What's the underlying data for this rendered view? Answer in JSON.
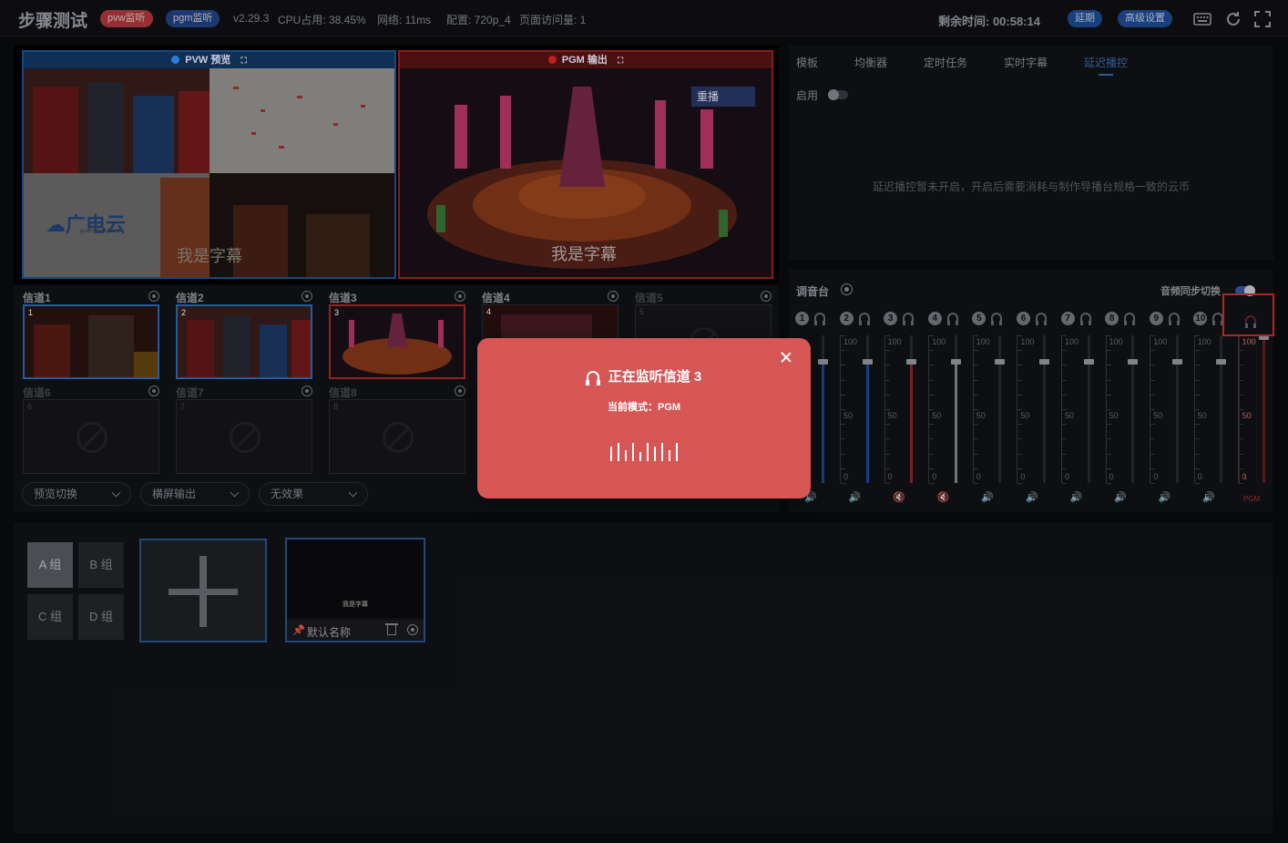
{
  "topbar": {
    "title": "步骤测试",
    "pvw_badge": "pvw监听",
    "pgm_badge": "pgm监听",
    "version": "v2.29.3",
    "cpu": "CPU占用: 38.45%",
    "network": "网络: 11ms",
    "config": "配置: 720p_4",
    "visits": "页面访问量: 1",
    "remaining": "剩余时间: 00:58:14",
    "extend_label": "延期",
    "advanced_label": "高级设置",
    "colors": {
      "pvw_badge": "#b8393f",
      "pgm_badge": "#21458b",
      "button": "#1f4e9a"
    }
  },
  "monitors": {
    "pvw_title": "PVW 预览",
    "pgm_title": "PGM 输出",
    "pvw_logo_text": "广电云",
    "pvw_logo_sub": "guangdianyun.tv",
    "caption": "我是字幕",
    "pgm_tag": "重播"
  },
  "channels": [
    {
      "label": "信道1",
      "num": "1"
    },
    {
      "label": "信道2",
      "num": "2"
    },
    {
      "label": "信道3",
      "num": "3"
    },
    {
      "label": "信道4",
      "num": "4"
    },
    {
      "label": "信道5",
      "num": "5"
    },
    {
      "label": "信道6",
      "num": "6"
    },
    {
      "label": "信道7",
      "num": "7"
    },
    {
      "label": "信道8",
      "num": "8"
    }
  ],
  "selects": {
    "switch_mode": "预览切换",
    "output_mode": "横屏输出",
    "effect": "无效果"
  },
  "right_panel": {
    "tabs": [
      "模板",
      "均衡器",
      "定时任务",
      "实时字幕",
      "延迟播控"
    ],
    "enable_label": "启用",
    "delay_message": "延迟播控暂未开启，开启后需要消耗与制作导播台规格一致的云币"
  },
  "mixer": {
    "title": "调音台",
    "sync_label": "音频同步切换",
    "channels": [
      {
        "num": "1",
        "level": 0.82,
        "fill": "#1c4d9c",
        "muted": false
      },
      {
        "num": "2",
        "level": 0.82,
        "fill": "#1c4d9c",
        "muted": false
      },
      {
        "num": "3",
        "level": 0.82,
        "fill": "#8c2a2a",
        "muted": true
      },
      {
        "num": "4",
        "level": 0.82,
        "fill": "#8a8f96",
        "muted": true
      },
      {
        "num": "5",
        "level": 0.82,
        "fill": "",
        "muted": false
      },
      {
        "num": "6",
        "level": 0.82,
        "fill": "",
        "muted": false
      },
      {
        "num": "7",
        "level": 0.82,
        "fill": "",
        "muted": false
      },
      {
        "num": "8",
        "level": 0.82,
        "fill": "",
        "muted": false
      },
      {
        "num": "9",
        "level": 0.82,
        "fill": "",
        "muted": false
      },
      {
        "num": "10",
        "level": 0.82,
        "fill": "",
        "muted": false
      }
    ],
    "pgm_scale": {
      "top": "100",
      "mid": "50",
      "bottom": "1"
    },
    "scale_top": "100",
    "scale_mid": "50",
    "scale_bottom": "0",
    "pgm_label": "PGM"
  },
  "groups": {
    "items": [
      "A 组",
      "B 组",
      "C 组",
      "D 组"
    ],
    "scene_name": "默认名称",
    "scene_caption": "我是字幕"
  },
  "modal": {
    "title": "正在监听信道 3",
    "mode": "当前模式：PGM",
    "color": "#d65656"
  }
}
